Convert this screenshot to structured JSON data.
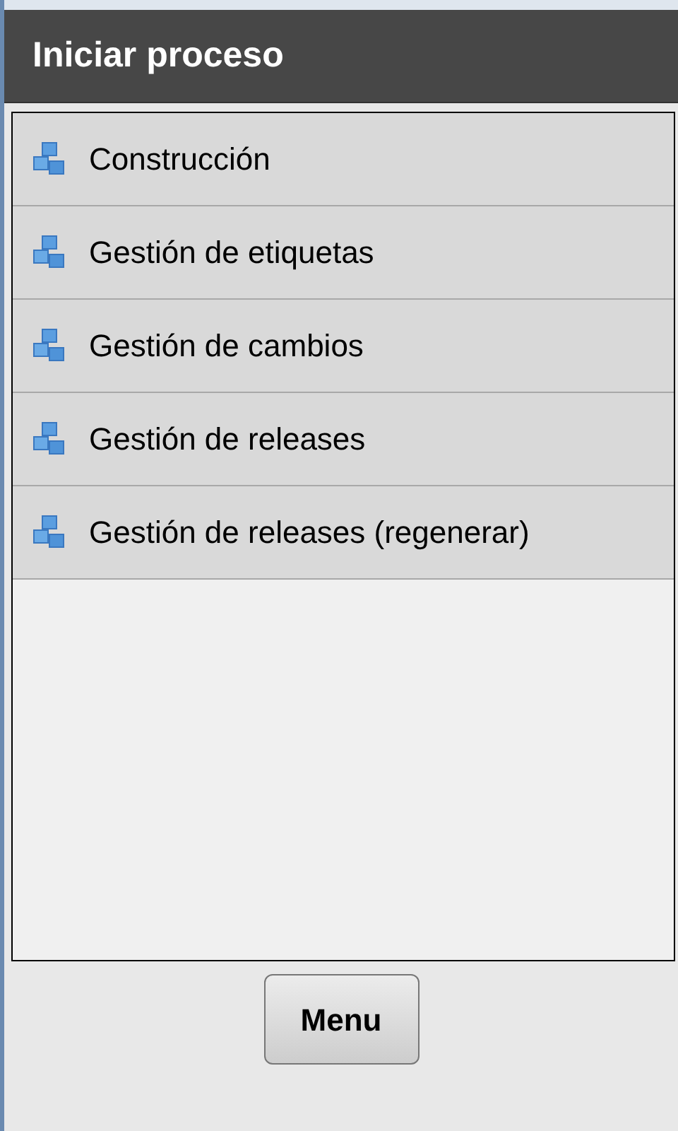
{
  "header": {
    "title": "Iniciar proceso"
  },
  "processes": [
    {
      "label": "Construcción"
    },
    {
      "label": "Gestión de etiquetas"
    },
    {
      "label": "Gestión de cambios"
    },
    {
      "label": "Gestión de releases"
    },
    {
      "label": "Gestión de releases (regenerar)"
    }
  ],
  "buttons": [
    {
      "label": "Menu"
    }
  ]
}
